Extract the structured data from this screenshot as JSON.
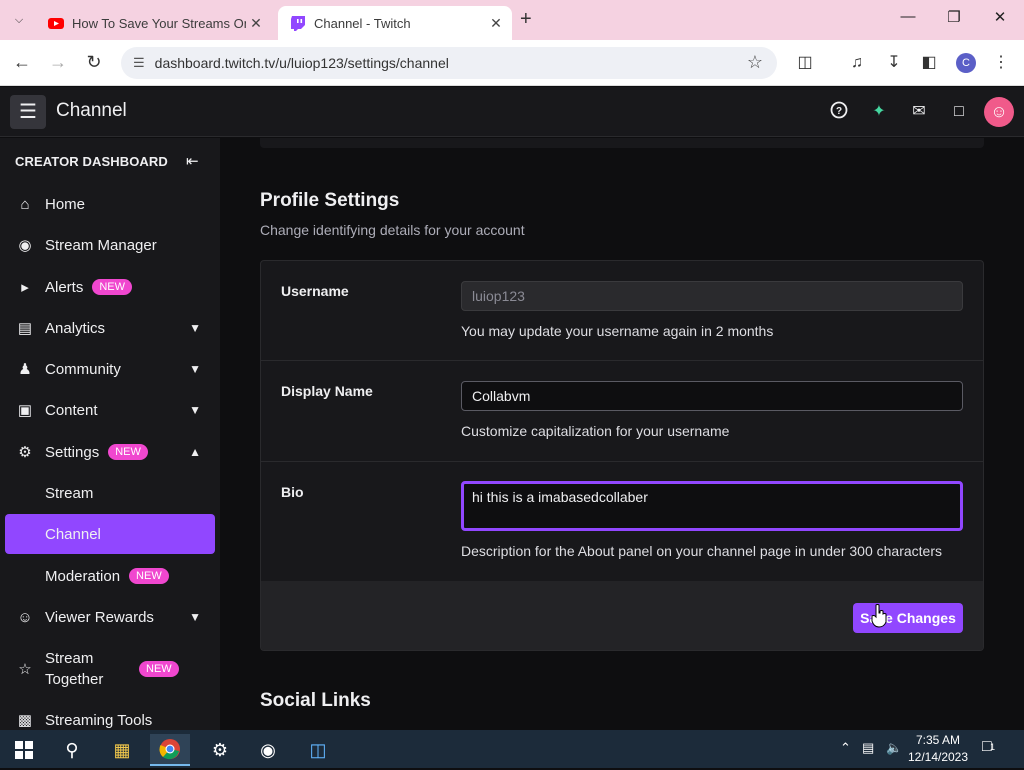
{
  "browser": {
    "tabs": [
      {
        "title": "How To Save Your Streams On",
        "active": false
      },
      {
        "title": "Channel - Twitch",
        "active": true
      }
    ],
    "url": "dashboard.twitch.tv/u/luiop123/settings/channel",
    "profile_initial": "C"
  },
  "topnav": {
    "title": "Channel"
  },
  "sidebar": {
    "heading": "CREATOR DASHBOARD",
    "items": [
      {
        "label": "Home"
      },
      {
        "label": "Stream Manager"
      },
      {
        "label": "Alerts",
        "badge": "NEW"
      },
      {
        "label": "Analytics"
      },
      {
        "label": "Community"
      },
      {
        "label": "Content"
      },
      {
        "label": "Settings",
        "badge": "NEW"
      },
      {
        "label": "Stream"
      },
      {
        "label": "Channel"
      },
      {
        "label": "Moderation",
        "badge": "NEW"
      },
      {
        "label": "Viewer Rewards"
      },
      {
        "label": "Stream Together",
        "badge": "NEW"
      },
      {
        "label": "Streaming Tools"
      }
    ]
  },
  "profile": {
    "title": "Profile Settings",
    "subtitle": "Change identifying details for your account",
    "username_label": "Username",
    "username_value": "luiop123",
    "username_hint": "You may update your username again in 2 months",
    "display_label": "Display Name",
    "display_value": "Collabvm",
    "display_hint": "Customize capitalization for your username",
    "bio_label": "Bio",
    "bio_value": "hi this is a imabasedcollaber ",
    "bio_hint": "Description for the About panel on your channel page in under 300 characters",
    "save_label": "Save Changes"
  },
  "social": {
    "title": "Social Links"
  },
  "taskbar": {
    "time": "7:35 AM",
    "date": "12/14/2023",
    "notification_count": "1"
  },
  "colors": {
    "accent": "#9147ff",
    "badge": "#f047cf",
    "background": "#0e0e10",
    "panel": "#18181b"
  }
}
